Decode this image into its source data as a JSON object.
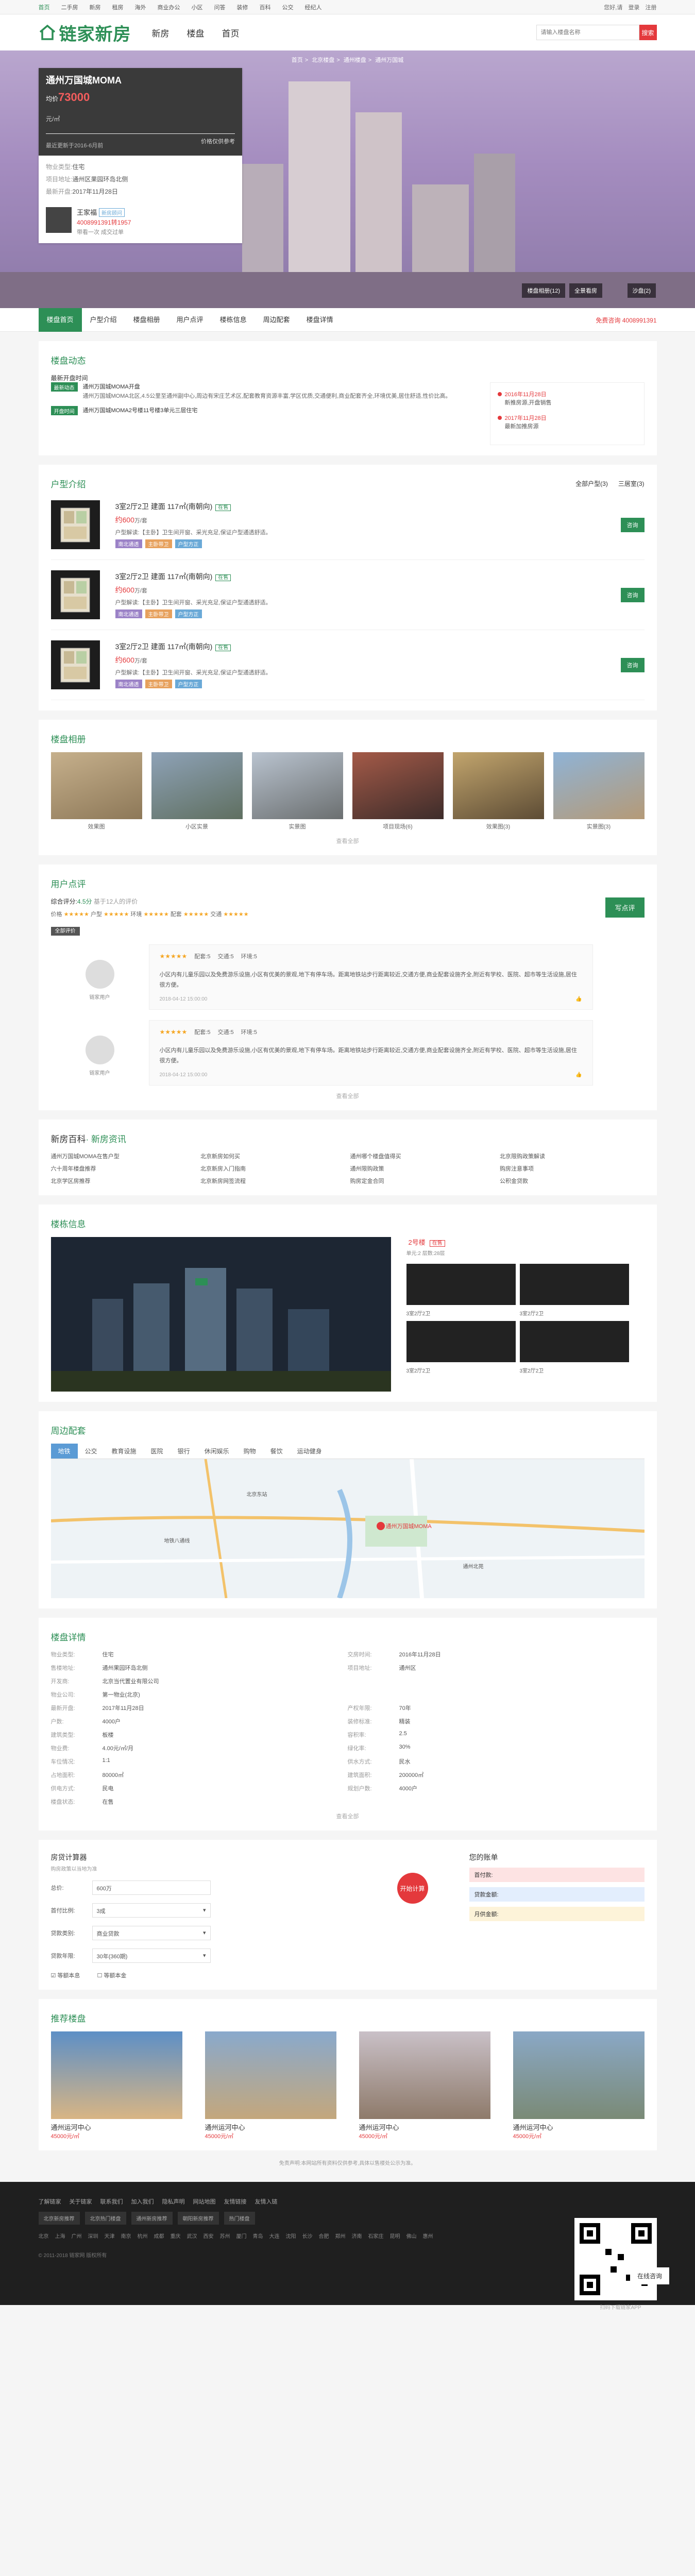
{
  "topbar": {
    "links": [
      "首页",
      "二手房",
      "新房",
      "租房",
      "海外",
      "商业办公",
      "小区",
      "问答",
      "装修",
      "百科",
      "公交",
      "经纪人"
    ],
    "right": [
      "您好,请",
      "登录",
      "注册"
    ]
  },
  "header": {
    "logo": "链家新房",
    "nav": [
      "新房",
      "楼盘",
      "首页"
    ],
    "search_placeholder": "请输入楼盘名称",
    "search_btn": "搜索"
  },
  "hero": {
    "breadcrumb": [
      "首页",
      "北京楼盘",
      "通州楼盘",
      "通州万国城"
    ],
    "title": "通州万国城MOMA",
    "price": "73000",
    "price_unit": "元/㎡",
    "update": "价格仅供参考",
    "sub": "最近更新于2016-6月前",
    "rows": [
      [
        "物业类型:",
        "住宅"
      ],
      [
        "项目地址:",
        "通州区果园环岛北侧"
      ],
      [
        "最新开盘:",
        "2017年11月28日"
      ]
    ],
    "agent": {
      "name": "王家福",
      "tag": "新房顾问",
      "phone": "4008991391转1957",
      "desc": "带看一次 成交过单"
    },
    "btn_a": "楼盘相册(12)",
    "btn_b": "全景看房",
    "btn_c": "沙盘(2)"
  },
  "subnav": {
    "tabs": [
      "楼盘首页",
      "户型介绍",
      "楼盘相册",
      "用户点评",
      "楼栋信息",
      "周边配套",
      "楼盘详情"
    ],
    "consult": "免费咨询 4008991391"
  },
  "dynamic": {
    "title": "楼盘动态",
    "hint": "最新开盘时间",
    "items": [
      {
        "lbl": "最新动态",
        "hd": "通州万国城MOMA开盘",
        "txt": "通州万国城MOMA北区,4.5公里至通州副中心,周边有宋庄艺术区,配套教育资源丰富,学区优质,交通便利,商业配套齐全,环境优美,居住舒适,性价比高。"
      },
      {
        "lbl": "开盘时间",
        "hd": "通州万国城MOMA2号楼11号楼3单元三层住宅",
        "txt": ""
      }
    ],
    "timeline": [
      {
        "date": "2016年11月28日",
        "text": "新推房源,开盘销售"
      },
      {
        "date": "2017年11月28日",
        "text": "最新加推房源"
      }
    ]
  },
  "units": {
    "title": "户型介绍",
    "tabs": [
      "全部户型(3)",
      "三居室(3)"
    ],
    "items": [
      {
        "name": "3室2厅2卫 建面 117㎡(南朝向)",
        "status": "在售",
        "price": "约600",
        "price_unit": "万/套",
        "desc": "户型解读:【主卧】卫生间开窗、采光充足,保证户型通透舒适。",
        "tags": [
          "南北通透",
          "主卧带卫",
          "户型方正"
        ]
      },
      {
        "name": "3室2厅2卫 建面 117㎡(南朝向)",
        "status": "在售",
        "price": "约600",
        "price_unit": "万/套",
        "desc": "户型解读:【主卧】卫生间开窗、采光充足,保证户型通透舒适。",
        "tags": [
          "南北通透",
          "主卧带卫",
          "户型方正"
        ]
      },
      {
        "name": "3室2厅2卫 建面 117㎡(南朝向)",
        "status": "在售",
        "price": "约600",
        "price_unit": "万/套",
        "desc": "户型解读:【主卧】卫生间开窗、采光充足,保证户型通透舒适。",
        "tags": [
          "南北通透",
          "主卧带卫",
          "户型方正"
        ]
      }
    ],
    "consult_btn": "咨询"
  },
  "photos": {
    "title": "楼盘相册",
    "captions": [
      "效果图",
      "小区实景",
      "实景图",
      "项目现场(6)",
      "效果图(3)",
      "实景图(3)"
    ],
    "more": "查看全部"
  },
  "reviews": {
    "title": "用户点评",
    "score_label": "综合评分:",
    "score": "4.5分",
    "count": "基于12人的评价",
    "items": [
      "价格",
      "户型",
      "环境",
      "配套",
      "交通"
    ],
    "write": "写点评",
    "tab": "全部评价",
    "list": [
      {
        "user": "链家用户",
        "stars": "★★★★★",
        "tags": [
          "配套:5",
          "交通:5",
          "环境:5"
        ],
        "body": "小区内有儿童乐园以及免费游乐设施,小区有优美的景观,地下有停车场。距离地铁站步行距离较近,交通方便,商业配套设施齐全,附近有学校、医院、超市等生活设施,居住很方便。",
        "date": "2018-04-12 15:00:00"
      },
      {
        "user": "链家用户",
        "stars": "★★★★★",
        "tags": [
          "配套:5",
          "交通:5",
          "环境:5"
        ],
        "body": "小区内有儿童乐园以及免费游乐设施,小区有优美的景观,地下有停车场。距离地铁站步行距离较近,交通方便,商业配套设施齐全,附近有学校、医院、超市等生活设施,居住很方便。",
        "date": "2018-04-12 15:00:00"
      }
    ],
    "more": "查看全部"
  },
  "news": {
    "title": "新房百科",
    "sub": "· 新房资讯",
    "items": [
      "通州万国城MOMA在售户型",
      "北京新房如何买",
      "通州哪个楼盘值得买",
      "北京限购政策解读",
      "六十周年楼盘推荐",
      "北京新房入门指南",
      "通州限购政策",
      "购房注意事项",
      "北京学区房推荐",
      "北京新房网签流程",
      "购房定金合同",
      "公积金贷款"
    ]
  },
  "sandbox": {
    "title": "楼栋信息",
    "building": "2号楼",
    "status": "在售",
    "sub": "单元:2  层数:28层",
    "plans": [
      "3室2厅2卫",
      "3室2厅2卫",
      "3室2厅2卫",
      "3室2厅2卫"
    ]
  },
  "map": {
    "title": "周边配套",
    "tabs": [
      "地铁",
      "公交",
      "教育设施",
      "医院",
      "银行",
      "休闲娱乐",
      "购物",
      "餐饮",
      "运动健身"
    ],
    "places": [
      "通州万国城MOMA",
      "北京东站",
      "地铁八通线",
      "通州北苑"
    ]
  },
  "detail": {
    "title": "楼盘详情",
    "rows": [
      [
        "物业类型:",
        "住宅",
        "交房时间:",
        "2016年11月28日"
      ],
      [
        "售楼地址:",
        "通州果园环岛北侧",
        "项目地址:",
        "通州区"
      ],
      [
        "开发商:",
        "北京当代置业有限公司",
        "",
        ""
      ],
      [
        "物业公司:",
        "第一物业(北京)",
        "",
        ""
      ],
      [
        "最新开盘:",
        "2017年11月28日",
        "产权年限:",
        "70年"
      ],
      [
        "户数:",
        "4000户",
        "装修标准:",
        "精装"
      ],
      [
        "建筑类型:",
        "板楼",
        "容积率:",
        "2.5"
      ],
      [
        "物业费:",
        "4.00元/㎡/月",
        "绿化率:",
        "30%"
      ],
      [
        "车位情况:",
        "1:1",
        "供水方式:",
        "民水"
      ],
      [
        "占地面积:",
        "80000㎡",
        "建筑面积:",
        "200000㎡"
      ],
      [
        "供电方式:",
        "民电",
        "规划户数:",
        "4000户"
      ],
      [
        "楼盘状态:",
        "在售",
        "",
        ""
      ]
    ],
    "more": "查看全部"
  },
  "calc": {
    "title": "房贷计算器",
    "sub": "购房政策以当地为准",
    "fields": [
      [
        "总价:",
        "600万"
      ],
      [
        "首付比例:",
        "3成"
      ],
      [
        "贷款类别:",
        "商业贷款"
      ],
      [
        "贷款年限:",
        "30年(360期)"
      ]
    ],
    "btn": "开始计算",
    "res_title": "您的账单",
    "res": [
      "首付款:",
      "贷款金额:",
      "月供金额:"
    ],
    "checks": [
      "等额本息",
      "等额本金"
    ]
  },
  "recommend": {
    "title": "推荐楼盘",
    "items": [
      {
        "name": "通州运河中心",
        "price": "45000元/㎡"
      },
      {
        "name": "通州运河中心",
        "price": "45000元/㎡"
      },
      {
        "name": "通州运河中心",
        "price": "45000元/㎡"
      },
      {
        "name": "通州运河中心",
        "price": "45000元/㎡"
      }
    ]
  },
  "notice": "免责声明:本网站所有资料仅供参考,具体以售楼处公示为准。",
  "footer": {
    "links": [
      "了解链家",
      "关于链家",
      "联系我们",
      "加入我们",
      "隐私声明",
      "网站地图",
      "友情链接",
      "友情入链"
    ],
    "chips": [
      "北京新房推荐",
      "北京热门楼盘",
      "通州新房推荐",
      "朝阳新房推荐",
      "热门楼盘"
    ],
    "cities": [
      "北京",
      "上海",
      "广州",
      "深圳",
      "天津",
      "南京",
      "杭州",
      "成都",
      "重庆",
      "武汉",
      "西安",
      "苏州",
      "厦门",
      "青岛",
      "大连",
      "沈阳",
      "长沙",
      "合肥",
      "郑州",
      "济南",
      "石家庄",
      "昆明",
      "佛山",
      "惠州"
    ],
    "copy": "© 2011-2018 链家网 版权所有",
    "qr_label": "扫码下载链家APP",
    "chat": "在线咨询"
  },
  "colors": {
    "brand": "#2d8f56",
    "accent": "#e4393c"
  }
}
